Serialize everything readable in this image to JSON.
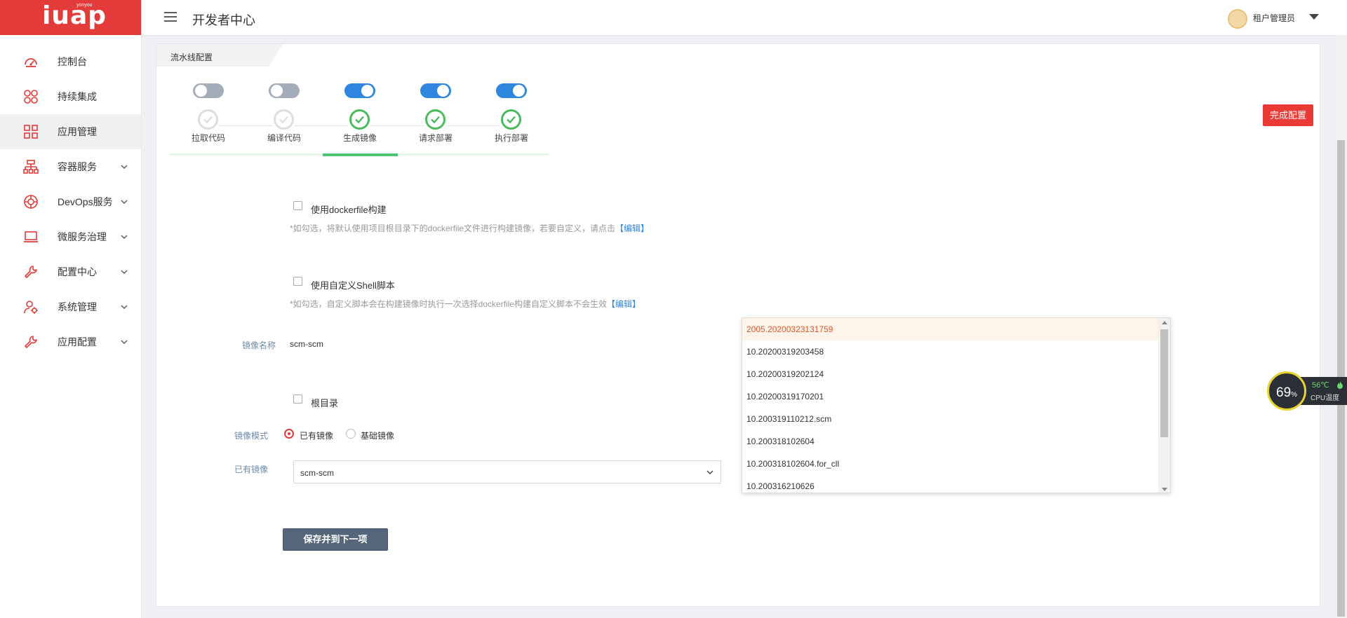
{
  "brand": {
    "logo": "iuap",
    "sub": "yonyou"
  },
  "sidebar": {
    "items": [
      {
        "label": "控制台",
        "icon": "dashboard-icon"
      },
      {
        "label": "持续集成",
        "icon": "integration-icon"
      },
      {
        "label": "应用管理",
        "icon": "apps-grid-icon"
      },
      {
        "label": "容器服务",
        "icon": "container-icon"
      },
      {
        "label": "DevOps服务",
        "icon": "devops-icon"
      },
      {
        "label": "微服务治理",
        "icon": "laptop-icon"
      },
      {
        "label": "配置中心",
        "icon": "wrench-icon"
      },
      {
        "label": "系统管理",
        "icon": "user-gear-icon"
      },
      {
        "label": "应用配置",
        "icon": "wrench-icon"
      }
    ]
  },
  "header": {
    "title": "开发者中心",
    "user": "租户管理员"
  },
  "card": {
    "tab": "流水线配置",
    "done_button": "完成配置"
  },
  "steps": [
    {
      "label": "拉取代码",
      "enabled": false,
      "done": false
    },
    {
      "label": "编译代码",
      "enabled": false,
      "done": false
    },
    {
      "label": "生成镜像",
      "enabled": true,
      "done": true
    },
    {
      "label": "请求部署",
      "enabled": true,
      "done": true
    },
    {
      "label": "执行部署",
      "enabled": true,
      "done": true
    }
  ],
  "form": {
    "dockerfile_label": "使用dockerfile构建",
    "dockerfile_hint": "*如勾选，将默认使用项目根目录下的dockerfile文件进行构建镜像，若要自定义，请点击",
    "shell_label": "使用自定义Shell脚本",
    "shell_hint": "*如勾选，自定义脚本会在构建镜像时执行一次选择dockerfile构建自定义脚本不会生效",
    "edit_link": "【编辑】",
    "image_name_label": "镜像名称",
    "image_name_value": "scm-scm",
    "root_label": "根目录",
    "mode_label": "镜像模式",
    "mode_existing": "已有镜像",
    "mode_base": "基础镜像",
    "existing_label": "已有镜像",
    "existing_value": "scm-scm",
    "save_button": "保存并到下一项"
  },
  "dropdown": {
    "options": [
      "2005.20200323131759",
      "10.20200319203458",
      "10.20200319202124",
      "10.20200319170201",
      "10.200319110212.scm",
      "10.200318102604",
      "10.200318102604.for_cll",
      "10.200316210626"
    ],
    "selected_index": 0
  },
  "cpu": {
    "percent": "69",
    "percent_unit": "%",
    "temp": "56℃",
    "temp_label": "CPU温度"
  },
  "colors": {
    "brand": "#e23b3a",
    "toggle_on": "#2e86de",
    "step_done": "#4cbb5c",
    "link": "#2e86de",
    "selected": "#e3542a"
  }
}
